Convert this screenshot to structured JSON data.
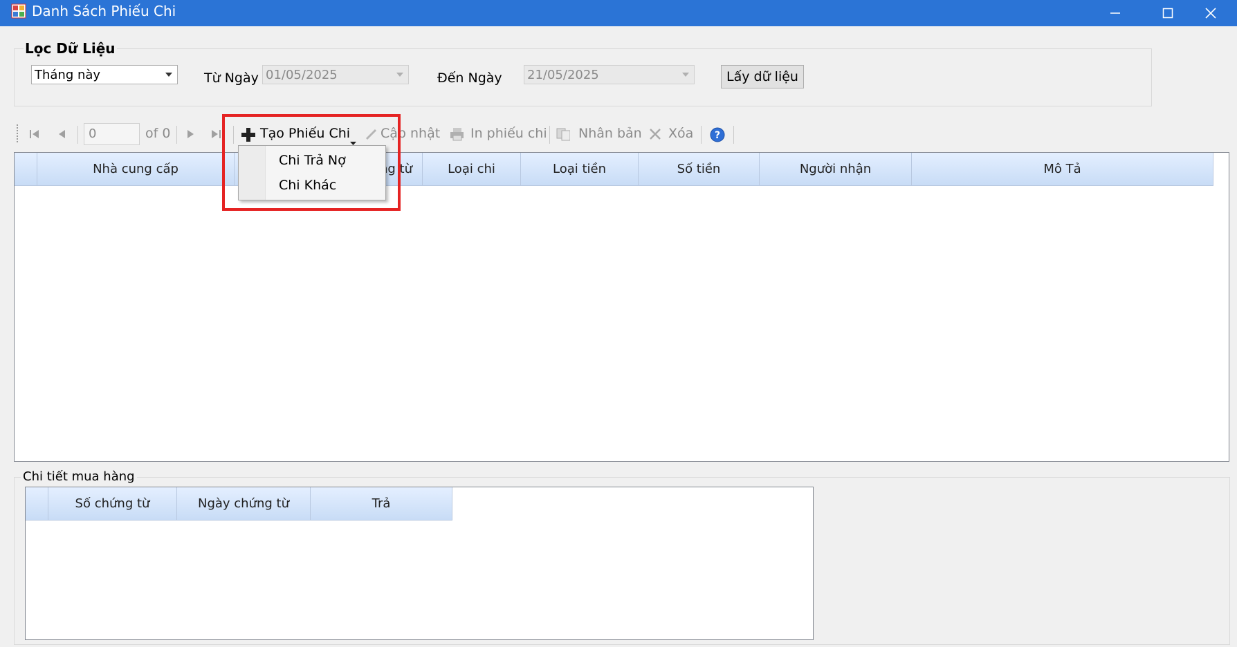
{
  "window": {
    "title": "Danh Sách Phiếu Chi",
    "controls": [
      "minimize",
      "maximize",
      "close"
    ]
  },
  "filter": {
    "group_title": "Lọc Dữ Liệu",
    "period_value": "Tháng này",
    "from_label": "Từ Ngày",
    "from_value": "01/05/2025",
    "to_label": "Đến Ngày",
    "to_value": "21/05/2025",
    "fetch_button": "Lấy dữ liệu"
  },
  "toolbar": {
    "page_input": "0",
    "page_of": "of 0",
    "create_label": "Tạo Phiếu Chi",
    "update_label": "Cập nhật",
    "print_label": "In phiếu chi",
    "duplicate_label": "Nhân bản",
    "delete_label": "Xóa"
  },
  "main_grid": {
    "columns": [
      "Nhà cung cấp",
      "Số chứng từ",
      "Loại chi",
      "Loại tiền",
      "Số tiền",
      "Người nhận",
      "Mô Tả"
    ],
    "visible_partial": [
      "ng từ"
    ]
  },
  "dropdown_menu": {
    "items": [
      "Chi Trả Nợ",
      "Chi Khác"
    ]
  },
  "detail": {
    "group_title": "Chi tiết mua hàng",
    "columns": [
      "Số chứng từ",
      "Ngày chứng từ",
      "Trả"
    ]
  },
  "colors": {
    "titlebar": "#2b74d6",
    "highlight": "#e52323",
    "header_gradient_top": "#e4efff",
    "header_gradient_bottom": "#c8dcf6"
  }
}
